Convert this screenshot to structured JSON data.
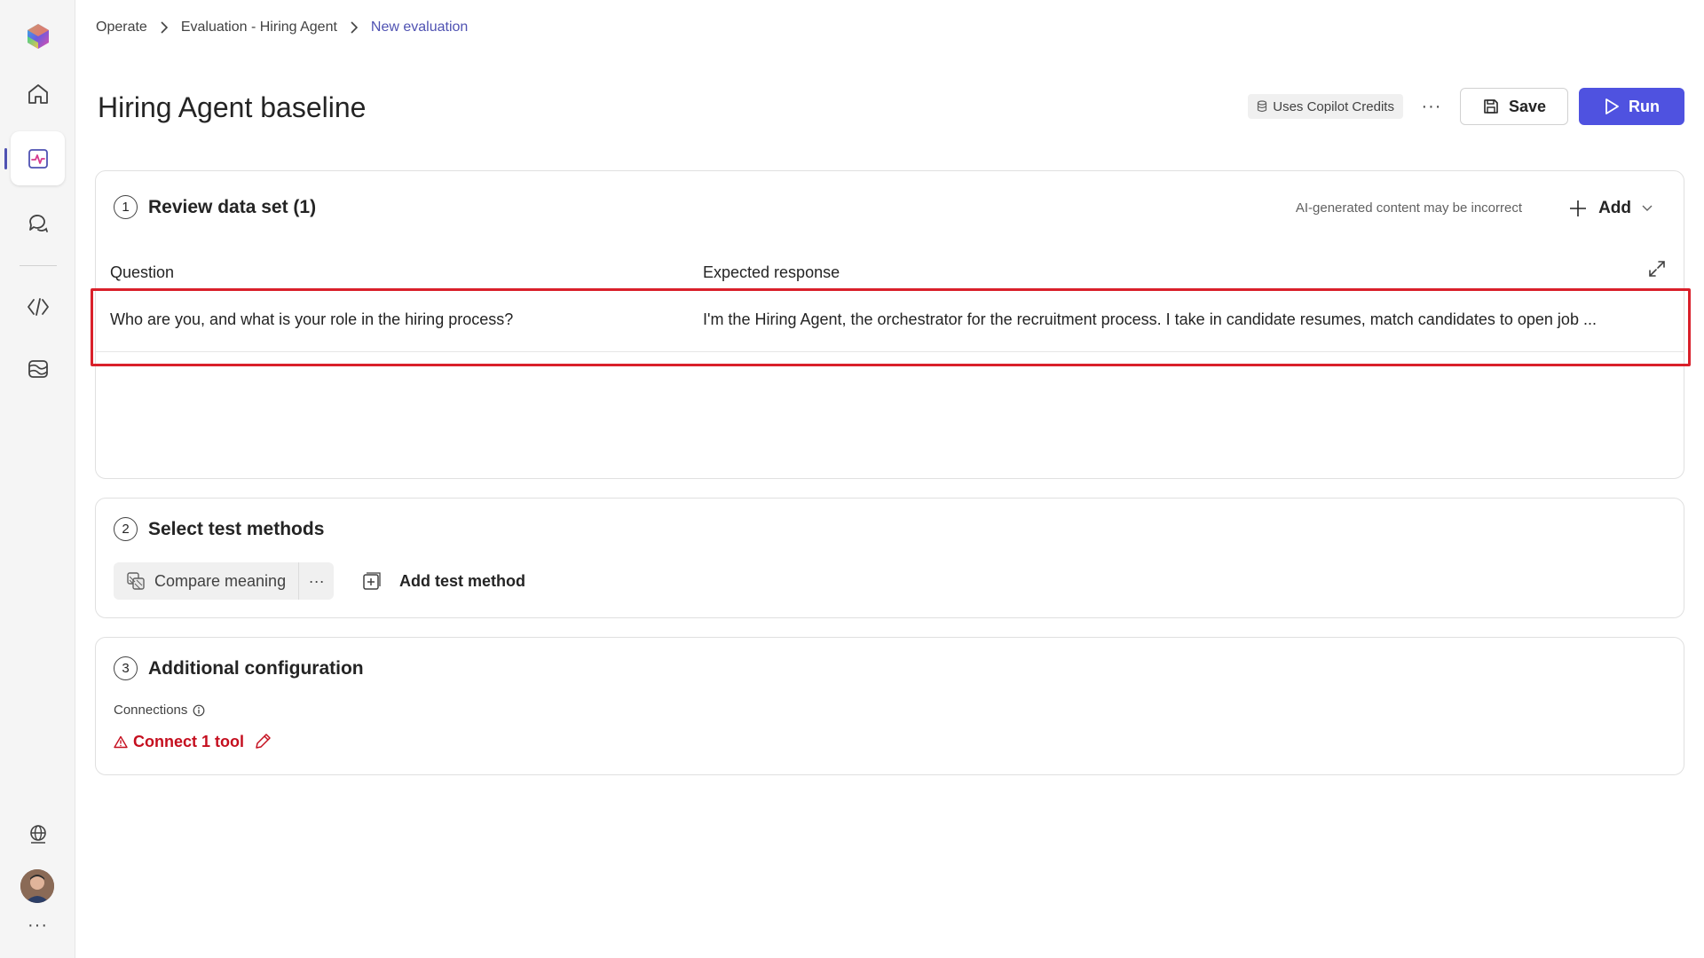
{
  "breadcrumb": {
    "items": [
      "Operate",
      "Evaluation - Hiring Agent"
    ],
    "current": "New evaluation"
  },
  "page": {
    "title": "Hiring Agent baseline"
  },
  "header": {
    "credits_label": "Uses Copilot Credits",
    "more": "···",
    "save_label": "Save",
    "run_label": "Run"
  },
  "section1": {
    "number": "1",
    "title": "Review data set (1)",
    "ai_note": "AI-generated content may be incorrect",
    "add_label": "Add",
    "columns": {
      "question": "Question",
      "expected": "Expected response"
    },
    "rows": [
      {
        "question": "Who are you, and what is your role in the hiring process?",
        "expected": "I'm the Hiring Agent, the orchestrator for the recruitment process. I take in candidate resumes, match candidates to open job ..."
      }
    ]
  },
  "section2": {
    "number": "2",
    "title": "Select test methods",
    "method_label": "Compare meaning",
    "method_more": "···",
    "add_method_label": "Add test method"
  },
  "section3": {
    "number": "3",
    "title": "Additional configuration",
    "connections_label": "Connections",
    "connect_label": "Connect 1 tool"
  },
  "rail": {
    "more": "···"
  },
  "colors": {
    "accent": "#4f52b2",
    "primary_button": "#4f52e0",
    "warning": "#c50f1f",
    "highlight": "#d9202a"
  }
}
